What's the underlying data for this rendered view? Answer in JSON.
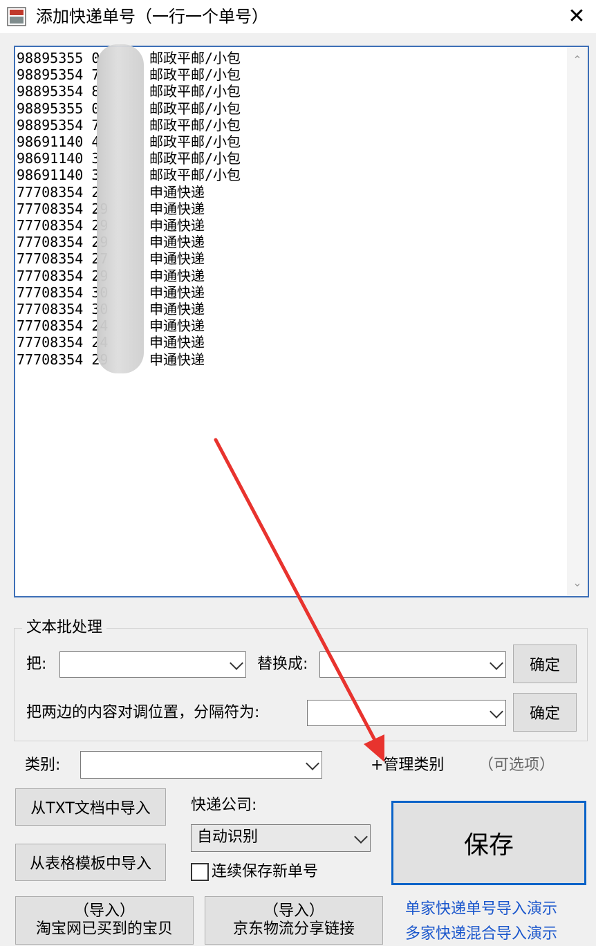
{
  "window": {
    "title": "添加快递单号（一行一个单号）",
    "close_glyph": "✕"
  },
  "textarea_lines": [
    {
      "num": "98895355 0",
      "carrier": "邮政平邮/小包"
    },
    {
      "num": "98895354 7",
      "carrier": "邮政平邮/小包"
    },
    {
      "num": "98895354 8",
      "carrier": "邮政平邮/小包"
    },
    {
      "num": "98895355 0",
      "carrier": "邮政平邮/小包"
    },
    {
      "num": "98895354 7",
      "carrier": "邮政平邮/小包"
    },
    {
      "num": "98691140 4",
      "carrier": "邮政平邮/小包"
    },
    {
      "num": "98691140 3",
      "carrier": "邮政平邮/小包"
    },
    {
      "num": "98691140 3",
      "carrier": "邮政平邮/小包"
    },
    {
      "num": "77708354 2",
      "carrier": "申通快递"
    },
    {
      "num": "77708354 29",
      "carrier": "申通快递"
    },
    {
      "num": "77708354 29",
      "carrier": "申通快递"
    },
    {
      "num": "77708354 29",
      "carrier": "申通快递"
    },
    {
      "num": "77708354 27",
      "carrier": "申通快递"
    },
    {
      "num": "77708354 29",
      "carrier": "申通快递"
    },
    {
      "num": "77708354 30",
      "carrier": "申通快递"
    },
    {
      "num": "77708354 30",
      "carrier": "申通快递"
    },
    {
      "num": "77708354 24",
      "carrier": "申通快递"
    },
    {
      "num": "77708354 24",
      "carrier": "申通快递"
    },
    {
      "num": "77708354 29",
      "carrier": "申通快递"
    }
  ],
  "scroll": {
    "up": "⌃",
    "down": "⌄"
  },
  "batch": {
    "group_title": "文本批处理",
    "replace_from_label": "把:",
    "replace_to_label": "替换成:",
    "confirm_label": "确定",
    "swap_label": "把两边的内容对调位置，分隔符为:",
    "confirm2_label": "确定"
  },
  "category": {
    "label": "类别:",
    "manage_link": "+管理类别",
    "optional_note": "（可选项）"
  },
  "import": {
    "txt_button": "从TXT文档中导入",
    "table_button": "从表格模板中导入",
    "taobao_line1": "（导入）",
    "taobao_line2": "淘宝网已买到的宝贝",
    "jd_line1": "（导入）",
    "jd_line2": "京东物流分享链接"
  },
  "courier": {
    "label": "快递公司:",
    "selected": "自动识别",
    "continuous_label": "连续保存新单号",
    "continuous_checked": false
  },
  "save_button": "保存",
  "demo_links": {
    "single": "单家快递单号导入演示",
    "multi": "多家快递混合导入演示"
  },
  "colors": {
    "accent": "#0a63c8",
    "link": "#1a56cc",
    "arrow": "#e8332e"
  }
}
